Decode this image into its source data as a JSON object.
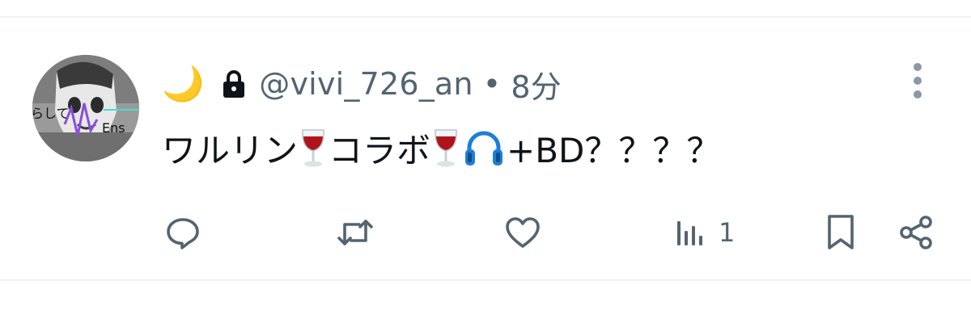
{
  "tweet": {
    "author": {
      "display_name": "🌙",
      "handle": "@vivi_726_an",
      "protected": true,
      "avatar_text_a": "らして",
      "avatar_text_b": "Ens"
    },
    "separator": "•",
    "time": "8分",
    "segments": [
      {
        "type": "text",
        "value": "ワルリン"
      },
      {
        "type": "icon",
        "icon": "wine-glass-icon"
      },
      {
        "type": "text",
        "value": "コラボ"
      },
      {
        "type": "icon",
        "icon": "wine-glass-icon"
      },
      {
        "type": "icon",
        "icon": "headphones-icon"
      },
      {
        "type": "text",
        "value": "+BD？？？？"
      }
    ],
    "text_part1": "ワルリン",
    "text_part2": "コラボ",
    "text_part3": "+BD？？？？"
  },
  "actions": {
    "reply": {
      "icon": "reply-icon"
    },
    "repost": {
      "icon": "repost-icon"
    },
    "like": {
      "icon": "heart-icon"
    },
    "views": {
      "icon": "views-chart-icon",
      "count": "1"
    },
    "bookmark": {
      "icon": "bookmark-icon"
    },
    "share": {
      "icon": "share-icon"
    }
  },
  "colors": {
    "text": "#0f1419",
    "secondary": "#536471",
    "divider": "#eff3f4",
    "headphones": "#1d7fd6",
    "wine": "#b0141b"
  }
}
